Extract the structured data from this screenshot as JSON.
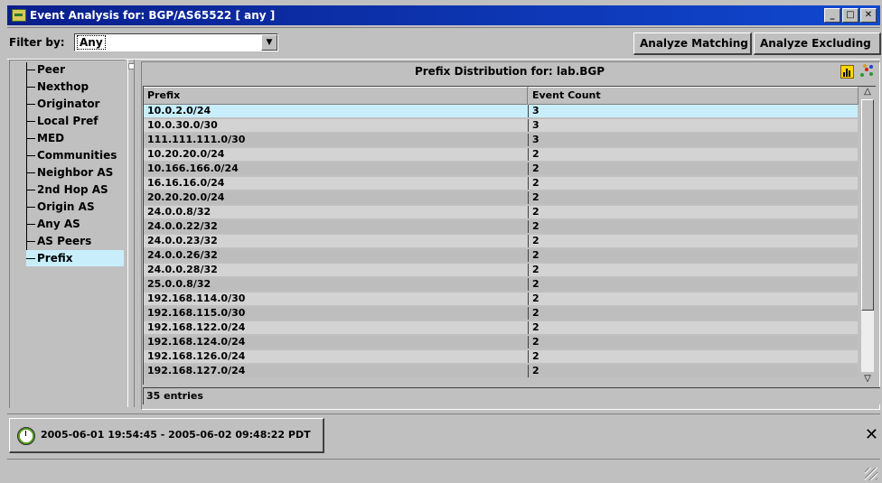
{
  "window": {
    "title": "Event Analysis for: BGP/AS65522 [  any ]",
    "controls": [
      "_",
      "□",
      "✕"
    ]
  },
  "filter": {
    "label": "Filter by:",
    "value": "Any",
    "dropdown_icon": "▼"
  },
  "actions": {
    "match_label": "Analyze Matching",
    "exclude_label": "Analyze Excluding"
  },
  "tree": {
    "items": [
      "Peer",
      "Nexthop",
      "Originator",
      "Local Pref",
      "MED",
      "Communities",
      "Neighbor AS",
      "2nd Hop AS",
      "Origin AS",
      "Any AS",
      "AS Peers",
      "Prefix"
    ],
    "selected": "Prefix"
  },
  "panel": {
    "title": "Prefix Distribution for: lab.BGP",
    "icons": [
      "bar-chart-icon",
      "scatter-plot-icon"
    ]
  },
  "table": {
    "columns": [
      "Prefix",
      "Event Count"
    ],
    "rows": [
      [
        "10.0.2.0/24",
        "3"
      ],
      [
        "10.0.30.0/30",
        "3"
      ],
      [
        "111.111.111.0/30",
        "3"
      ],
      [
        "10.20.20.0/24",
        "2"
      ],
      [
        "10.166.166.0/24",
        "2"
      ],
      [
        "16.16.16.0/24",
        "2"
      ],
      [
        "20.20.20.0/24",
        "2"
      ],
      [
        "24.0.0.8/32",
        "2"
      ],
      [
        "24.0.0.22/32",
        "2"
      ],
      [
        "24.0.0.23/32",
        "2"
      ],
      [
        "24.0.0.26/32",
        "2"
      ],
      [
        "24.0.0.28/32",
        "2"
      ],
      [
        "25.0.0.8/32",
        "2"
      ],
      [
        "192.168.114.0/30",
        "2"
      ],
      [
        "192.168.115.0/30",
        "2"
      ],
      [
        "192.168.122.0/24",
        "2"
      ],
      [
        "192.168.124.0/24",
        "2"
      ],
      [
        "192.168.126.0/24",
        "2"
      ],
      [
        "192.168.127.0/24",
        "2"
      ]
    ],
    "selected_row": 0,
    "footer": "35 entries"
  },
  "time": {
    "range": "2005-06-01 19:54:45 - 2005-06-02 09:48:22 PDT",
    "close": "✕"
  },
  "colors": {
    "title_bar": "#0a1e8c",
    "selection": "#c8eefc"
  }
}
